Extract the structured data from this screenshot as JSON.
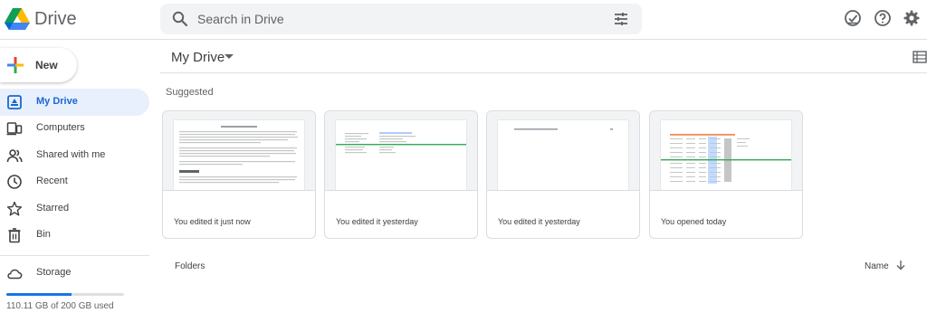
{
  "app": {
    "name": "Drive"
  },
  "search": {
    "placeholder": "Search in Drive"
  },
  "header": {
    "icons": [
      "search-icon",
      "tune-icon",
      "offline-check-icon",
      "help-icon",
      "settings-icon"
    ]
  },
  "new_button": {
    "label": "New"
  },
  "sidebar": {
    "items": [
      {
        "label": "My Drive",
        "icon": "my-drive-icon",
        "active": true
      },
      {
        "label": "Computers",
        "icon": "computers-icon"
      },
      {
        "label": "Shared with me",
        "icon": "shared-icon"
      },
      {
        "label": "Recent",
        "icon": "clock-icon"
      },
      {
        "label": "Starred",
        "icon": "star-icon"
      },
      {
        "label": "Bin",
        "icon": "trash-icon"
      }
    ],
    "storage": {
      "label": "Storage",
      "used_text": "110.11 GB of 200 GB used",
      "used_fraction": 0.55
    }
  },
  "main": {
    "title": "My Drive",
    "suggested_label": "Suggested",
    "cards": [
      {
        "caption": "You edited it just now"
      },
      {
        "caption": "You edited it yesterday"
      },
      {
        "caption": "You edited it yesterday"
      },
      {
        "caption": "You opened today"
      }
    ],
    "folders_label": "Folders",
    "sort_label": "Name"
  },
  "colors": {
    "accent": "#1a73e8",
    "active_bg": "#e8f0fe",
    "active_text": "#1967d2",
    "search_bg": "#f1f3f4"
  }
}
